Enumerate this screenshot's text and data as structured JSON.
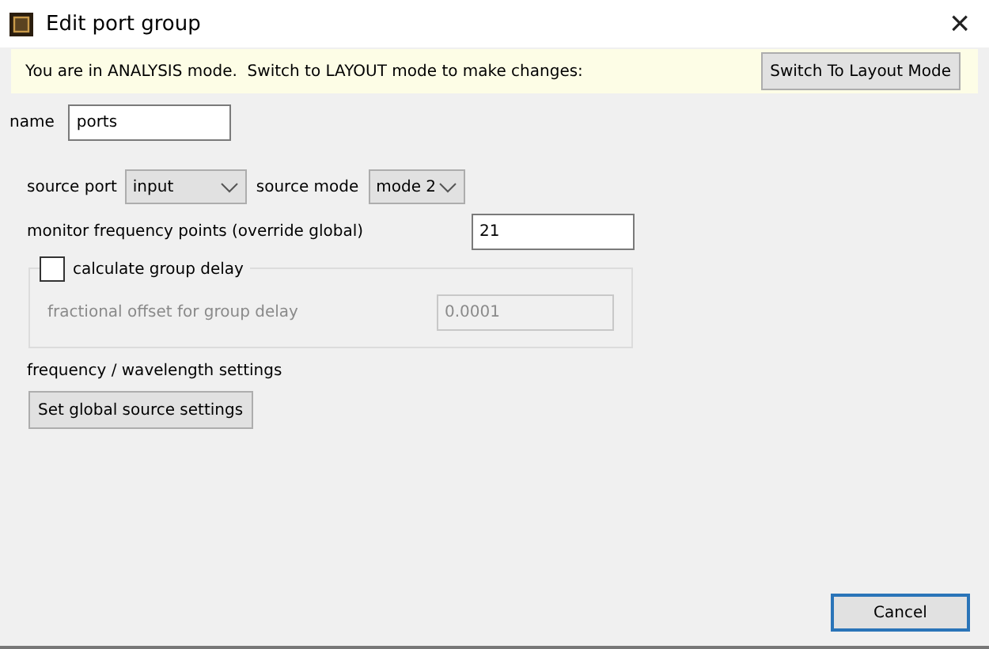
{
  "window": {
    "title": "Edit port group",
    "close": "×"
  },
  "banner": {
    "message": "You are in ANALYSIS mode.  Switch to LAYOUT mode to make changes:",
    "button": "Switch To Layout Mode"
  },
  "name": {
    "label": "name",
    "value": "ports"
  },
  "source_port": {
    "label": "source port",
    "value": "input"
  },
  "source_mode": {
    "label": "source mode",
    "value": "mode 2"
  },
  "monitor_points": {
    "label": "monitor frequency points (override global)",
    "value": "21"
  },
  "group_delay": {
    "label": "calculate group delay",
    "checked": false,
    "offset_label": "fractional offset for group delay",
    "offset_value": "0.0001",
    "disabled": true
  },
  "frequency_label": "frequency / wavelength settings",
  "global_button": "Set global source settings",
  "cancel_button": "Cancel"
}
